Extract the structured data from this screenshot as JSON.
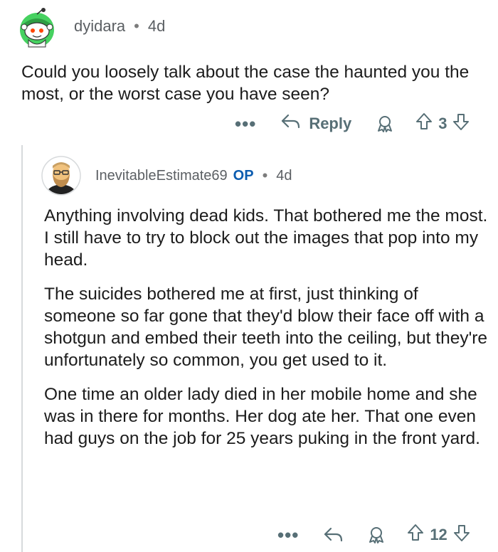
{
  "parent_comment": {
    "username": "dyidara",
    "separator": "•",
    "age": "4d",
    "body": "Could you loosely talk about the case the haunted you the most, or the worst case you have seen?",
    "actions": {
      "more_label": "•••",
      "reply_label": "Reply",
      "score": "3"
    }
  },
  "reply_comment": {
    "username": "InevitableEstimate69",
    "op_badge": "OP",
    "separator": "•",
    "age": "4d",
    "paragraphs": [
      "Anything involving dead kids. That bothered me the most. I still have to try to block out the images that pop into my head.",
      "The suicides bothered me at first, just thinking of someone so far gone that they'd blow their face off with a shotgun and embed their teeth into the ceiling, but they're unfortunately so common, you get used to it.",
      "One time an older lady died in her mobile home and she was in there for months. Her dog ate her. That one even had guys on the job for 25 years puking in the front yard."
    ],
    "actions": {
      "more_label": "•••",
      "score": "12"
    }
  },
  "icons": [
    "snoo-avatar-icon",
    "bearded-avatar-icon",
    "more-icon",
    "reply-arrow-icon",
    "award-icon",
    "upvote-icon",
    "downvote-icon"
  ],
  "colors": {
    "text": "#1c1c1c",
    "meta": "#5b5f63",
    "action": "#576f76",
    "op_badge": "#0b5cb0",
    "thread_line": "#d7dadc",
    "snoo_green": "#46d160"
  }
}
